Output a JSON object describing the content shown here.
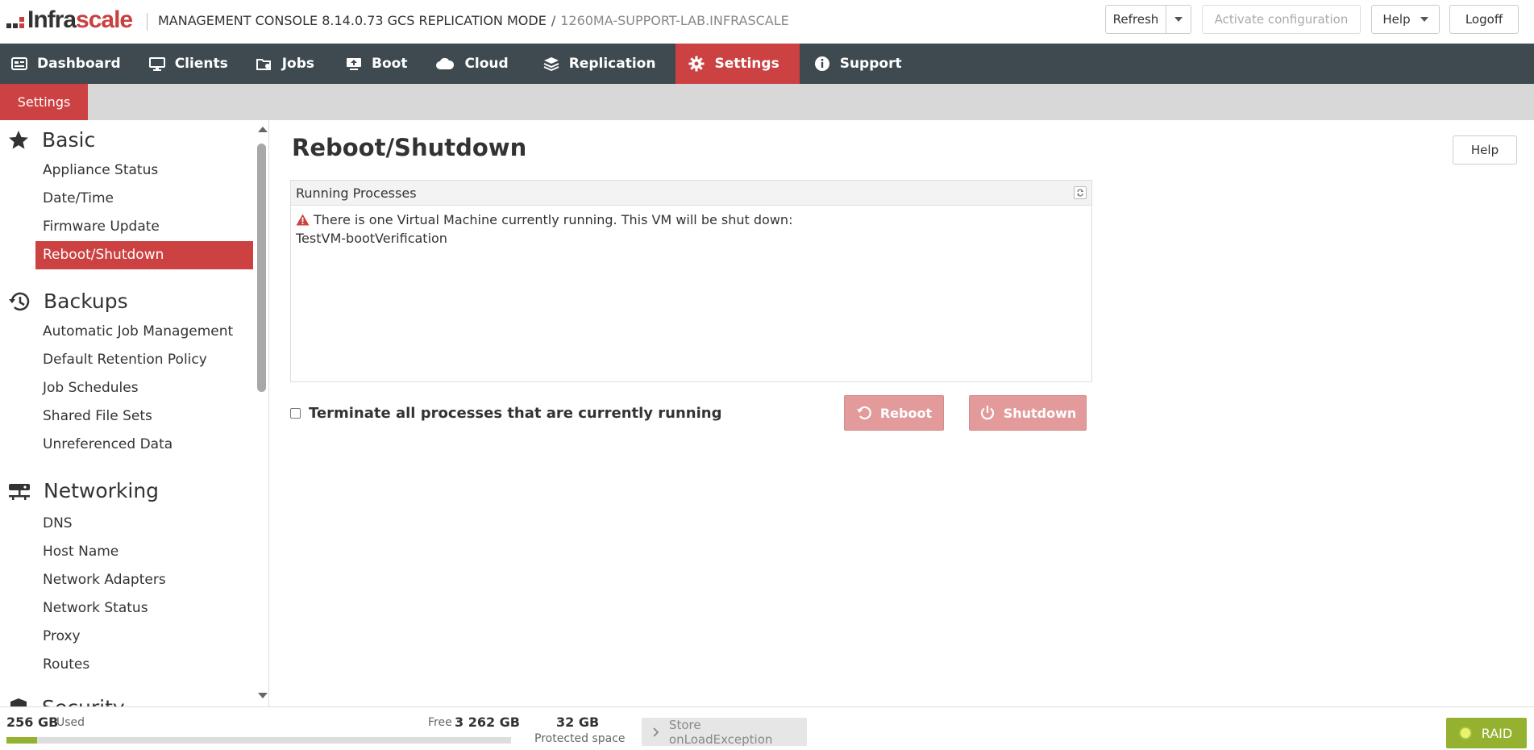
{
  "header": {
    "logo_a": "Infra",
    "logo_b": "scale",
    "title": "MANAGEMENT CONSOLE 8.14.0.73 GCS REPLICATION MODE",
    "slash": "/",
    "host": "1260MA-SUPPORT-LAB.INFRASCALE",
    "refresh_label": "Refresh",
    "activate_label": "Activate configuration",
    "help_label": "Help",
    "logoff_label": "Logoff"
  },
  "nav": {
    "items": [
      {
        "label": "Dashboard",
        "icon": "dashboard-icon"
      },
      {
        "label": "Clients",
        "icon": "monitor-icon"
      },
      {
        "label": "Jobs",
        "icon": "jobs-icon"
      },
      {
        "label": "Boot",
        "icon": "boot-icon"
      },
      {
        "label": "Cloud",
        "icon": "cloud-icon"
      },
      {
        "label": "Replication",
        "icon": "layers-icon"
      },
      {
        "label": "Settings",
        "icon": "gear-icon"
      },
      {
        "label": "Support",
        "icon": "info-icon"
      }
    ],
    "active": "Settings"
  },
  "subnav": {
    "tab": "Settings"
  },
  "sidebar": {
    "sections": [
      {
        "title": "Basic",
        "icon": "star-icon",
        "items": [
          "Appliance Status",
          "Date/Time",
          "Firmware Update",
          "Reboot/Shutdown"
        ]
      },
      {
        "title": "Backups",
        "icon": "history-icon",
        "items": [
          "Automatic Job Management",
          "Default Retention Policy",
          "Job Schedules",
          "Shared File Sets",
          "Unreferenced Data"
        ]
      },
      {
        "title": "Networking",
        "icon": "network-icon",
        "items": [
          "DNS",
          "Host Name",
          "Network Adapters",
          "Network Status",
          "Proxy",
          "Routes"
        ]
      },
      {
        "title": "Security",
        "icon": "shield-icon",
        "items": []
      }
    ],
    "active_item": "Reboot/Shutdown"
  },
  "main": {
    "title": "Reboot/Shutdown",
    "help_label": "Help",
    "panel": {
      "title": "Running Processes",
      "warning": "There is one Virtual Machine currently running. This VM will be shut down:",
      "vm_name": "TestVM-bootVerification"
    },
    "terminate_label": "Terminate all processes that are currently running",
    "terminate_checked": false,
    "reboot_label": "Reboot",
    "shutdown_label": "Shutdown"
  },
  "footer": {
    "used_value": "256 GB",
    "used_label": "Used",
    "free_label": "Free",
    "free_value": "3 262 GB",
    "usage_percent": 6,
    "protected_value": "32 GB",
    "protected_label": "Protected space",
    "store_label": "Store onLoadException",
    "raid_label": "RAID"
  },
  "colors": {
    "accent": "#cc4141",
    "nav_bg": "#3e4a4f",
    "raid": "#94b22f",
    "disabled_button": "#e39a9a"
  }
}
